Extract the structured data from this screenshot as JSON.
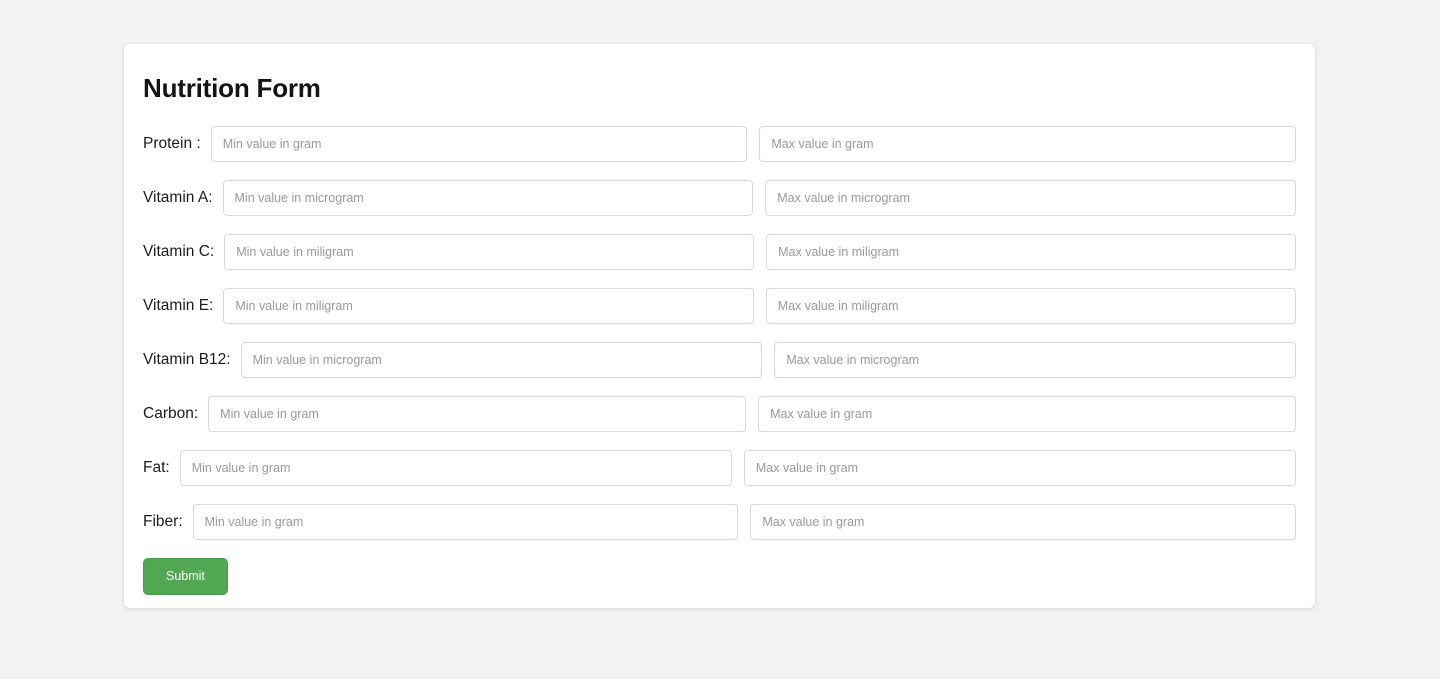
{
  "page": {
    "background_color": "#f2f2f3"
  },
  "card": {
    "background_color": "#ffffff",
    "title": "Nutrition Form"
  },
  "form": {
    "rows": [
      {
        "label": "Protein :",
        "min_placeholder": "Min value in gram",
        "max_placeholder": "Max value in gram",
        "min_value": "",
        "max_value": ""
      },
      {
        "label": "Vitamin A:",
        "min_placeholder": "Min value in microgram",
        "max_placeholder": "Max value in microgram",
        "min_value": "",
        "max_value": ""
      },
      {
        "label": "Vitamin C:",
        "min_placeholder": "Min value in miligram",
        "max_placeholder": "Max value in miligram",
        "min_value": "",
        "max_value": ""
      },
      {
        "label": "Vitamin E:",
        "min_placeholder": "Min value in miligram",
        "max_placeholder": "Max value in miligram",
        "min_value": "",
        "max_value": ""
      },
      {
        "label": "Vitamin B12:",
        "min_placeholder": "Min value in microgram",
        "max_placeholder": "Max value in microgram",
        "min_value": "",
        "max_value": ""
      },
      {
        "label": "Carbon:",
        "min_placeholder": "Min value in gram",
        "max_placeholder": "Max value in gram",
        "min_value": "",
        "max_value": ""
      },
      {
        "label": "Fat:",
        "min_placeholder": "Min value in gram",
        "max_placeholder": "Max value in gram",
        "min_value": "",
        "max_value": ""
      },
      {
        "label": "Fiber:",
        "min_placeholder": "Min value in gram",
        "max_placeholder": "Max value in gram",
        "min_value": "",
        "max_value": ""
      }
    ],
    "submit_label": "Submit",
    "submit_color": "#52a852"
  }
}
